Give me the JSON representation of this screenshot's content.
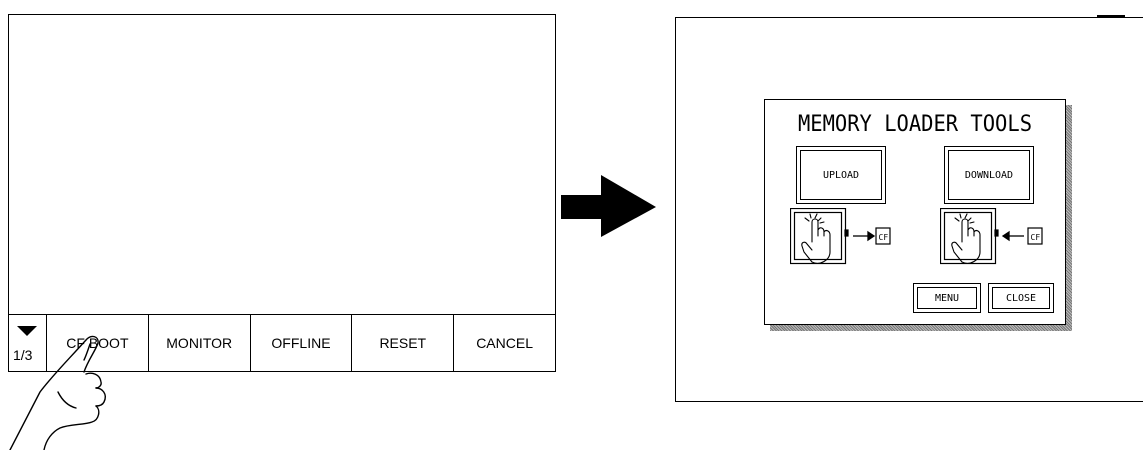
{
  "left_screen": {
    "menu": {
      "page_indicator": "1/3",
      "buttons": [
        "CF BOOT",
        "MONITOR",
        "OFFLINE",
        "RESET",
        "CANCEL"
      ]
    }
  },
  "dialog": {
    "title": "MEMORY LOADER TOOLS",
    "upload_label": "UPLOAD",
    "download_label": "DOWNLOAD",
    "upload_cf_label": "CF",
    "download_cf_label": "CF",
    "menu_label": "MENU",
    "close_label": "CLOSE"
  }
}
